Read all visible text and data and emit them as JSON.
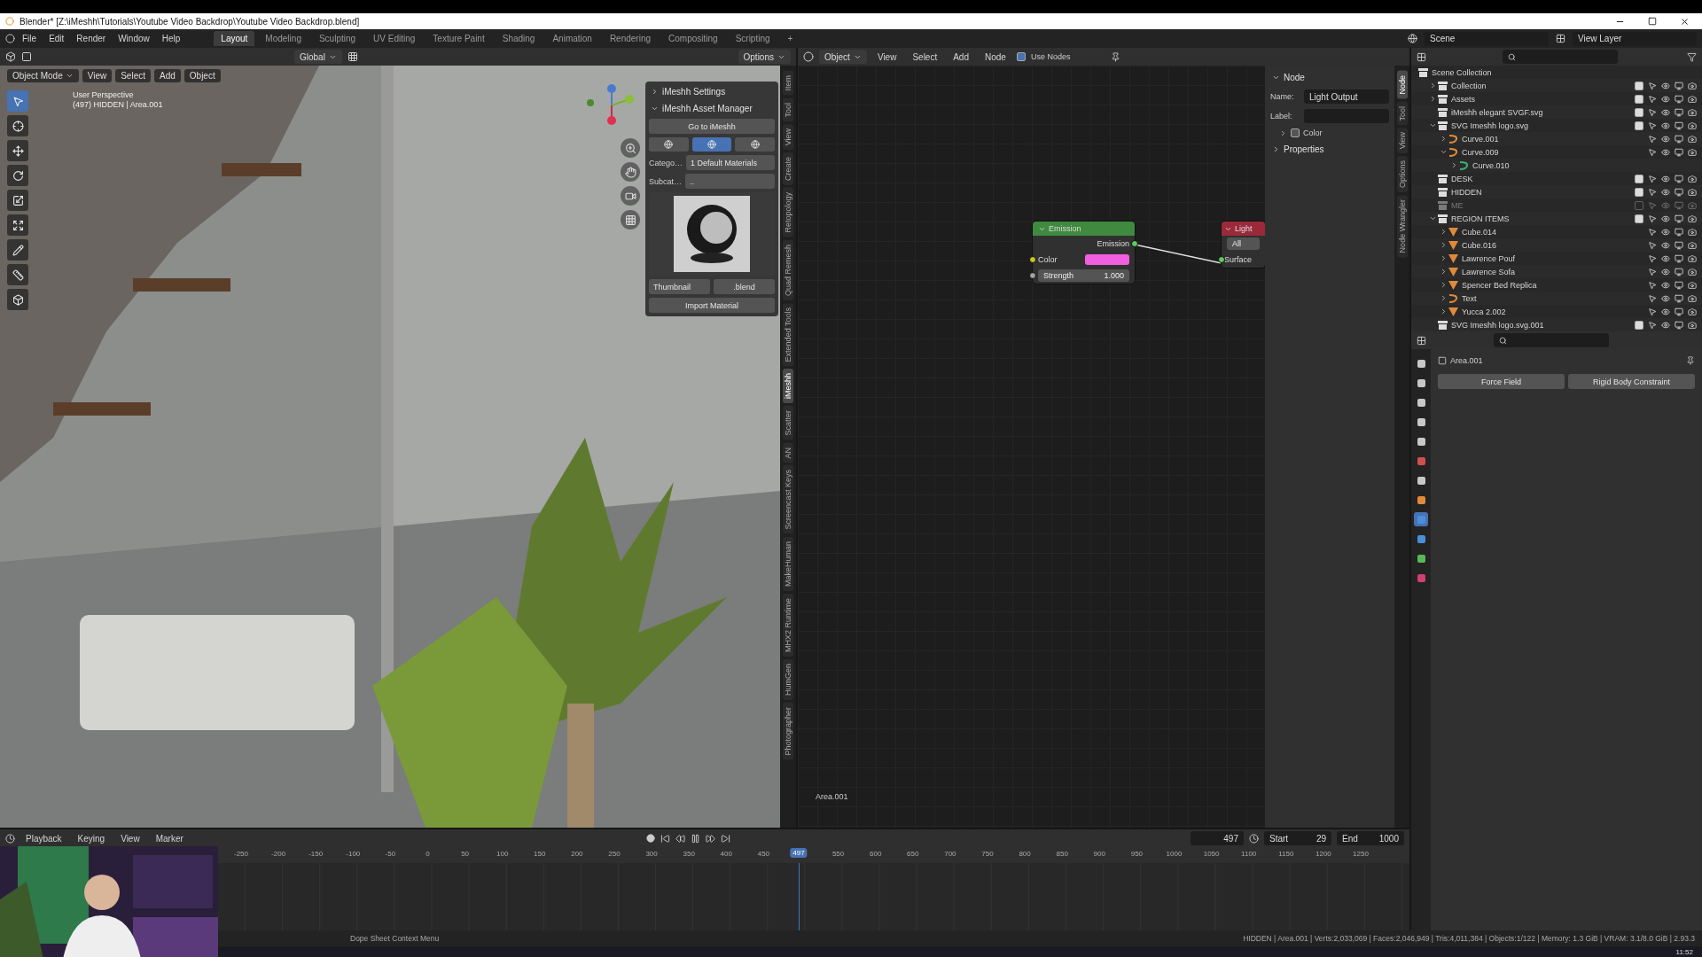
{
  "window": {
    "title": "Blender* [Z:\\iMeshh\\Tutorials\\Youtube Video Backdrop\\Youtube Video Backdrop.blend]"
  },
  "menu": [
    "File",
    "Edit",
    "Render",
    "Window",
    "Help"
  ],
  "workspaces": [
    {
      "label": "Layout",
      "selected": true
    },
    {
      "label": "Modeling",
      "selected": false
    },
    {
      "label": "Sculpting",
      "selected": false
    },
    {
      "label": "UV Editing",
      "selected": false
    },
    {
      "label": "Texture Paint",
      "selected": false
    },
    {
      "label": "Shading",
      "selected": false
    },
    {
      "label": "Animation",
      "selected": false
    },
    {
      "label": "Rendering",
      "selected": false
    },
    {
      "label": "Compositing",
      "selected": false
    },
    {
      "label": "Scripting",
      "selected": false
    },
    {
      "label": "+",
      "selected": false
    }
  ],
  "scene": {
    "scene": "Scene",
    "view_layer": "View Layer"
  },
  "viewport": {
    "orientation": "Global",
    "options": "Options",
    "mode": "Object Mode",
    "menus": [
      "View",
      "Select",
      "Add",
      "Object"
    ],
    "overlay": [
      "User Perspective",
      "(497) HIDDEN | Area.001"
    ],
    "tools": [
      {
        "selected": true
      },
      {
        "selected": false
      },
      {
        "selected": false
      },
      {
        "selected": false
      },
      {
        "selected": false
      },
      {
        "selected": false
      },
      {
        "selected": false
      },
      {
        "selected": false
      },
      {
        "selected": false
      }
    ],
    "tabs": [
      {
        "label": "Item",
        "selected": false
      },
      {
        "label": "Tool",
        "selected": false
      },
      {
        "label": "View",
        "selected": false
      },
      {
        "label": "Create",
        "selected": false
      },
      {
        "label": "Retopology",
        "selected": false
      },
      {
        "label": "Quad Remesh",
        "selected": false
      },
      {
        "label": "Extended Tools",
        "selected": false
      },
      {
        "label": "iMeshh",
        "selected": true
      },
      {
        "label": "Scatter",
        "selected": false
      },
      {
        "label": "AN",
        "selected": false
      },
      {
        "label": "Screencast Keys",
        "selected": false
      },
      {
        "label": "MakeHuman",
        "selected": false
      },
      {
        "label": "MHX2 Runtime",
        "selected": false
      },
      {
        "label": "HumGen",
        "selected": false
      },
      {
        "label": "Photographer",
        "selected": false
      }
    ],
    "panel": {
      "sections": [
        {
          "label": "iMeshh Settings",
          "expanded": false
        },
        {
          "label": "iMeshh Asset Manager",
          "expanded": true
        }
      ],
      "goto": "Go to iMeshh",
      "modes": [
        {
          "selected": false
        },
        {
          "selected": true
        },
        {
          "selected": false
        }
      ],
      "category": {
        "label": "Catego…",
        "value": "1 Default Materials"
      },
      "subcategory": {
        "label": "Subcat…",
        "value": ".."
      },
      "thumbnail": "Thumbnail",
      "blend": ".blend",
      "import": "Import Material"
    }
  },
  "node_editor": {
    "object": "Object",
    "menus": [
      "View",
      "Select",
      "Add",
      "Node"
    ],
    "use_nodes": {
      "label": "Use Nodes",
      "checked": true
    },
    "emission": {
      "title": "Emission",
      "output": "Emission",
      "color_label": "Color",
      "color": "#f25ee0",
      "strength_label": "Strength",
      "strength": "1.000"
    },
    "output": {
      "title": "Light",
      "target": "All",
      "input": "Surface"
    },
    "area_label": "Area.001",
    "side": {
      "title": "Node",
      "name_label": "Name:",
      "name": "Light Output",
      "label_label": "Label:",
      "color": {
        "label": "Color",
        "expanded": false,
        "checked": false
      },
      "properties": {
        "label": "Properties",
        "expanded": false
      }
    },
    "tabs": [
      {
        "label": "Node",
        "selected": true
      },
      {
        "label": "Tool",
        "selected": false
      },
      {
        "label": "View",
        "selected": false
      },
      {
        "label": "Options",
        "selected": false
      },
      {
        "label": "Node Wrangler",
        "selected": false
      }
    ]
  },
  "outliner": {
    "root": "Scene Collection",
    "items": [
      {
        "name": "Collection",
        "kind": "collection",
        "expanded": false,
        "checked": true
      },
      {
        "name": "Assets",
        "kind": "collection",
        "expanded": false,
        "checked": true
      },
      {
        "name": "iMeshh elegant SVGF.svg",
        "kind": "collection",
        "checked": true
      },
      {
        "name": "SVG Imeshh logo.svg",
        "kind": "collection",
        "expanded": true,
        "checked": true,
        "children": [
          {
            "name": "Curve.001",
            "kind": "curve",
            "expanded": false
          },
          {
            "name": "Curve.009",
            "kind": "curve",
            "expanded": true,
            "children": [
              {
                "name": "Curve.010",
                "kind": "curve_data",
                "expanded": false
              }
            ]
          }
        ]
      },
      {
        "name": "DESK",
        "kind": "collection",
        "checked": true
      },
      {
        "name": "HIDDEN",
        "kind": "collection",
        "checked": true
      },
      {
        "name": "ME",
        "kind": "collection",
        "checked": false
      },
      {
        "name": "REGION ITEMS",
        "kind": "collection",
        "expanded": true,
        "checked": true,
        "children": [
          {
            "name": "Cube.014",
            "kind": "mesh",
            "expanded": false
          },
          {
            "name": "Cube.016",
            "kind": "mesh",
            "expanded": false
          },
          {
            "name": "Lawrence Pouf",
            "kind": "mesh",
            "expanded": false
          },
          {
            "name": "Lawrence Sofa",
            "kind": "mesh",
            "expanded": false
          },
          {
            "name": "Spencer Bed Replica",
            "kind": "mesh",
            "expanded": false
          },
          {
            "name": "Text",
            "kind": "curve",
            "expanded": false
          },
          {
            "name": "Yucca 2.002",
            "kind": "mesh",
            "expanded": false
          }
        ]
      },
      {
        "name": "SVG Imeshh logo.svg.001",
        "kind": "collection",
        "checked": true
      }
    ]
  },
  "properties": {
    "object": "Area.001",
    "buttons": [
      "Force Field",
      "Rigid Body Constraint"
    ],
    "tabs": [
      {
        "color": "#c8c8c8",
        "selected": false
      },
      {
        "color": "#c8c8c8",
        "selected": false
      },
      {
        "color": "#c8c8c8",
        "selected": false
      },
      {
        "color": "#c8c8c8",
        "selected": false
      },
      {
        "color": "#c8c8c8",
        "selected": false
      },
      {
        "color": "#d05050",
        "selected": false
      },
      {
        "color": "#c8c8c8",
        "selected": false
      },
      {
        "color": "#e08a3a",
        "selected": false
      },
      {
        "color": "#4a90d9",
        "selected": true
      },
      {
        "color": "#4a90d9",
        "selected": false
      },
      {
        "color": "#58b858",
        "selected": false
      },
      {
        "color": "#d04070",
        "selected": false
      }
    ]
  },
  "timeline": {
    "menus": [
      "Playback",
      "Keying",
      "View",
      "Marker"
    ],
    "frame": "497",
    "start_label": "Start",
    "start": "29",
    "end_label": "End",
    "end": "1000",
    "ticks": [
      "-250",
      "-200",
      "-150",
      "-100",
      "-50",
      "0",
      "50",
      "100",
      "150",
      "200",
      "250",
      "300",
      "350",
      "400",
      "450",
      "550",
      "600",
      "650",
      "700",
      "750",
      "800",
      "850",
      "900",
      "950",
      "1000",
      "1050",
      "1100",
      "1150",
      "1200",
      "1250"
    ],
    "current": "497"
  },
  "status_bar": {
    "context": "Dope Sheet Context Menu",
    "stats": "HIDDEN | Area.001 | Verts:2,033,069 | Faces:2,046,949 | Tris:4,011,384 | Objects:1/122 | Memory: 1.3 GiB | VRAM: 3.1/8.0 GiB | 2.93.3"
  },
  "taskbar": {
    "clock": "11:52"
  }
}
